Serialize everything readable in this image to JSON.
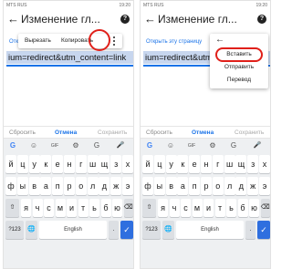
{
  "status_bar": {
    "carrier": "MTS RUS",
    "time_and_battery": "19:20"
  },
  "title": "Изменение гл...",
  "hint_left": "Отк",
  "hint_right": "Открыть эту страницу",
  "url_text": "ium=redirect&utm_content=link",
  "popup_toolbar": {
    "cut": "Вырезать",
    "copy": "Копировать"
  },
  "context_menu": {
    "paste": "Вставить",
    "send": "Отправить",
    "translate": "Перевод"
  },
  "actions": {
    "reset": "Сбросить",
    "cancel": "Отмена",
    "save": "Сохранить"
  },
  "keyboard": {
    "toolbar": [
      "G",
      "☺",
      "GIF",
      "⚙",
      "G",
      "🎤"
    ],
    "row1": [
      "й",
      "ц",
      "у",
      "к",
      "е",
      "н",
      "г",
      "ш",
      "щ",
      "з",
      "х"
    ],
    "row2": [
      "ф",
      "ы",
      "в",
      "а",
      "п",
      "р",
      "о",
      "л",
      "д",
      "ж",
      "э"
    ],
    "row3": [
      "я",
      "ч",
      "с",
      "м",
      "и",
      "т",
      "ь",
      "б",
      "ю"
    ],
    "shift": "⇧",
    "backspace": "⌫",
    "numbers_key": "?123",
    "globe": "🌐",
    "space_label": "English",
    "period": ".",
    "enter": "✓"
  },
  "colors": {
    "accent": "#1a73e8",
    "highlight": "#c7d6ee",
    "annotation": "#e0201a",
    "keyboard_bg": "#eef0f2"
  }
}
